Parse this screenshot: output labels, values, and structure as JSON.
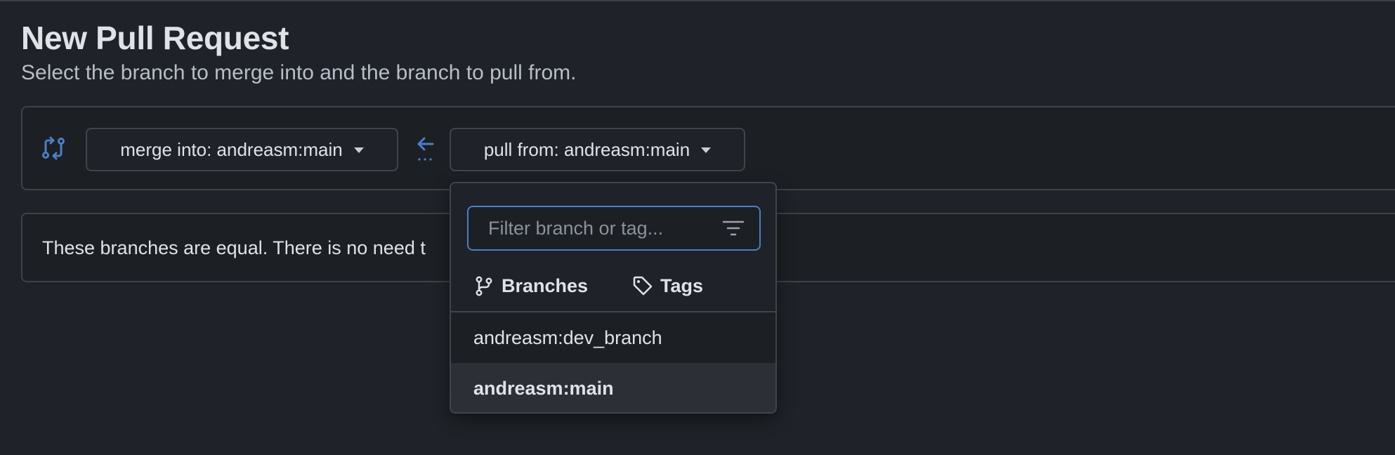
{
  "page": {
    "title": "New Pull Request",
    "subtitle": "Select the branch to merge into and the branch to pull from."
  },
  "compare": {
    "icon": "git-compare-icon",
    "merge_label": "merge into: andreasm:main",
    "arrow_icon": "arrow-left-icon",
    "pull_label": "pull from: andreasm:main"
  },
  "status": {
    "message": "These branches are equal. There is no need t"
  },
  "dropdown": {
    "filter_placeholder": "Filter branch or tag...",
    "filter_value": "",
    "tabs": [
      {
        "label": "Branches",
        "icon": "git-branch-icon"
      },
      {
        "label": "Tags",
        "icon": "tag-icon"
      }
    ],
    "branches": [
      {
        "label": "andreasm:dev_branch",
        "selected": false
      },
      {
        "label": "andreasm:main",
        "selected": true
      }
    ]
  },
  "colors": {
    "background": "#1f2228",
    "accent": "#4a7fc8",
    "border": "#3d434b",
    "text": "#dfe3e8",
    "muted_text": "#b8bec6"
  }
}
